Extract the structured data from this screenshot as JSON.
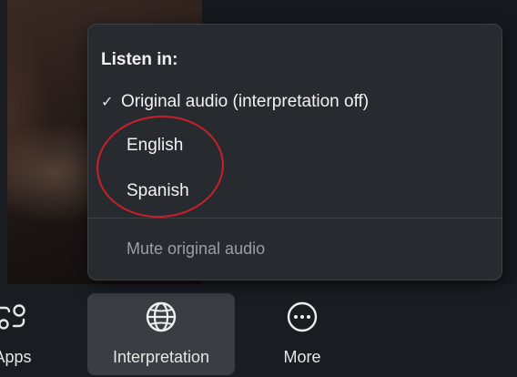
{
  "popup": {
    "heading": "Listen in:",
    "items": [
      {
        "label": "Original audio (interpretation off)",
        "checked": true,
        "check_glyph": "✓"
      },
      {
        "label": "English",
        "checked": false
      },
      {
        "label": "Spanish",
        "checked": false
      }
    ],
    "mute_label": "Mute original audio"
  },
  "annotation": {
    "color": "#c8202a"
  },
  "toolbar": {
    "buttons": [
      {
        "label": "Apps",
        "icon": "apps-icon",
        "active": false
      },
      {
        "label": "Interpretation",
        "icon": "globe-icon",
        "active": true
      },
      {
        "label": "More",
        "icon": "more-icon",
        "active": false
      }
    ]
  }
}
